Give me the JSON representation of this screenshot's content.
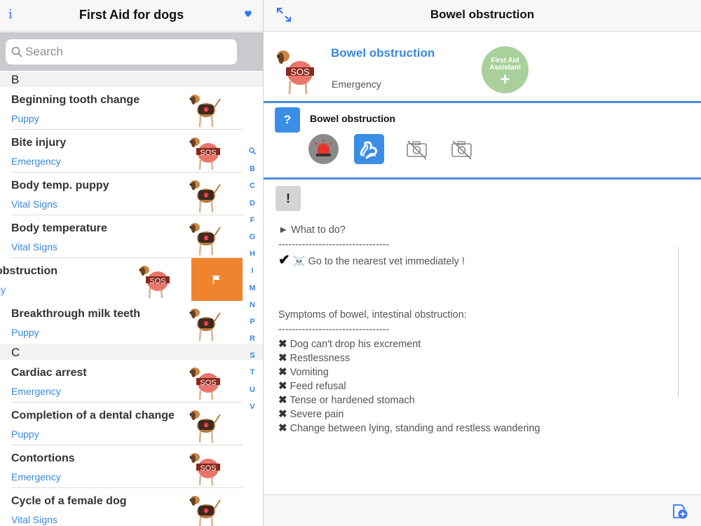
{
  "left_header": {
    "info_label": "i",
    "title": "First Aid for dogs"
  },
  "search": {
    "placeholder": "Search"
  },
  "sections": [
    {
      "letter": "B",
      "rows": [
        {
          "title": "Beginning tooth change",
          "category": "Puppy",
          "icon": "dog-info-icon"
        },
        {
          "title": "Bite injury",
          "category": "Emergency",
          "icon": "dog-sos-icon",
          "badge": "SOS"
        },
        {
          "title": "Body temp. puppy",
          "category": "Vital Signs",
          "icon": "dog-info-icon"
        },
        {
          "title": "Body temperature",
          "category": "Vital Signs",
          "icon": "dog-info-icon"
        },
        {
          "title": "obstruction",
          "category": "cy",
          "icon": "dog-sos-icon",
          "badge": "SOS",
          "swiped": true
        },
        {
          "title": "Breakthrough milk teeth",
          "category": "Puppy",
          "icon": "dog-info-icon"
        }
      ]
    },
    {
      "letter": "C",
      "rows": [
        {
          "title": "Cardiac arrest",
          "category": "Emergency",
          "icon": "dog-sos-icon",
          "badge": "SOS"
        },
        {
          "title": "Completion of a dental change",
          "category": "Puppy",
          "icon": "dog-info-icon"
        },
        {
          "title": "Contortions",
          "category": "Emergency",
          "icon": "dog-sos-icon",
          "badge": "SOS"
        },
        {
          "title": "Cycle of a female dog",
          "category": "Vital Signs",
          "icon": "dog-info-icon"
        }
      ]
    }
  ],
  "index_letters": [
    "B",
    "C",
    "D",
    "F",
    "G",
    "H",
    "I",
    "M",
    "N",
    "P",
    "R",
    "S",
    "T",
    "U",
    "V"
  ],
  "right_header": {
    "title": "Bowel obstruction"
  },
  "detail": {
    "title": "Bowel obstruction",
    "category": "Emergency",
    "badge": "SOS",
    "assistant_label": "First Aid Assistant",
    "assistant_plus": "+",
    "question_badge": "?",
    "question_title": "Bowel obstruction",
    "exclaim_badge": "!",
    "what_to_do": "► What to do?",
    "divider": "---------------------------------",
    "action_check": "✔",
    "action_text": "☠️ Go to the nearest vet immediately !",
    "symptoms_heading": "Symptoms of bowel, intestinal obstruction:",
    "symptom_mark": "✖",
    "symptoms": [
      "Dog can't drop his excrement",
      "Restlessness",
      "Vomiting",
      "Feed refusal",
      "Tense or hardened stomach",
      "Severe pain",
      "Change between lying, standing and restless wandering"
    ]
  },
  "colors": {
    "accent": "#3a88dd",
    "swipe_action": "#f0832d",
    "assistant": "#a9d09a",
    "divider_blue": "#4a90d9"
  }
}
